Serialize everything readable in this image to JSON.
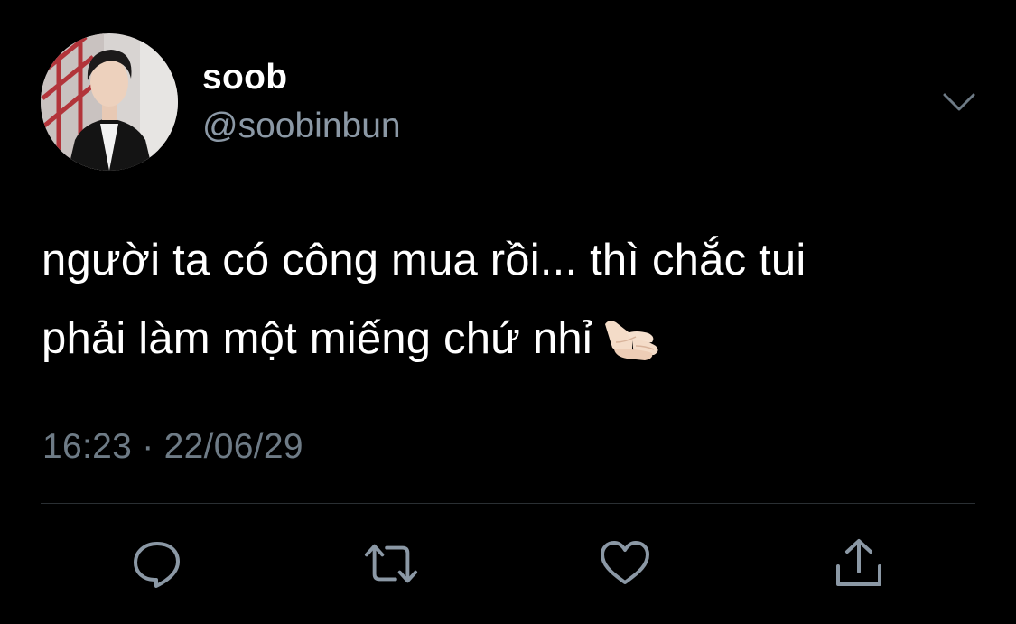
{
  "user": {
    "display_name": "soob",
    "handle": "@soobinbun"
  },
  "tweet": {
    "lines": [
      "người ta có công mua rồi... thì chắc tui",
      "phải làm một miếng chứ nhỉ"
    ],
    "emoji": "call-me-hand-light-skin-tone",
    "timestamp": "16:23 · 22/06/29"
  },
  "actions": [
    "reply-icon",
    "retweet-icon",
    "like-icon",
    "share-icon"
  ],
  "colors": {
    "background": "#000000",
    "text": "#ffffff",
    "secondary": "#8b98a5",
    "timestamp": "#6e7b86",
    "icon": "#8b98a5",
    "divider": "#2a2f33"
  }
}
